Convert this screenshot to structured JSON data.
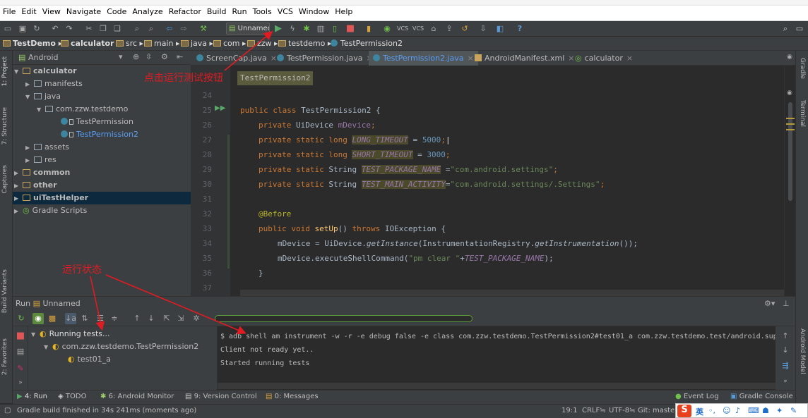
{
  "menu": [
    "File",
    "Edit",
    "View",
    "Navigate",
    "Code",
    "Analyze",
    "Refactor",
    "Build",
    "Run",
    "Tools",
    "VCS",
    "Window",
    "Help"
  ],
  "toolbar": {
    "run_config": "Unnamed"
  },
  "breadcrumb": [
    "TestDemo",
    "calculator",
    "src",
    "main",
    "java",
    "com",
    "zzw",
    "testdemo",
    "TestPermission2"
  ],
  "project_panel": {
    "module_selector": "Android",
    "tree": [
      {
        "label": "calculator"
      },
      {
        "label": "manifests"
      },
      {
        "label": "java"
      },
      {
        "label": "com.zzw.testdemo"
      },
      {
        "label": "TestPermission"
      },
      {
        "label": "TestPermission2"
      },
      {
        "label": "assets"
      },
      {
        "label": "res"
      },
      {
        "label": "common"
      },
      {
        "label": "other"
      },
      {
        "label": "uiTestHelper"
      },
      {
        "label": "Gradle Scripts"
      }
    ]
  },
  "side_tabs_left": [
    "1: Project",
    "7: Structure",
    "Captures",
    "Build Variants",
    "2: Favorites"
  ],
  "side_tabs_right": [
    "Gradle",
    "Terminal",
    "Android Model"
  ],
  "editor_tabs": [
    {
      "label": "ScreenCap.java"
    },
    {
      "label": "TestPermission.java"
    },
    {
      "label": "TestPermission2.java"
    },
    {
      "label": "AndroidManifest.xml"
    },
    {
      "label": "calculator"
    }
  ],
  "editor": {
    "popup": "TestPermission2",
    "line_numbers": [
      "24",
      "25",
      "26",
      "27",
      "28",
      "29",
      "30",
      "31",
      "32",
      "33",
      "34",
      "35",
      "36",
      "37"
    ],
    "code": {
      "l25": [
        "public class ",
        "TestPermission2 {"
      ],
      "l26": [
        "private ",
        "UiDevice ",
        "mDevice",
        ";"
      ],
      "l27": [
        "private static long ",
        "LONG_TIMEOUT",
        " = ",
        "5000",
        ";"
      ],
      "l28": [
        "private static long ",
        "SHORT_TIMEOUT",
        " = ",
        "3000",
        ";"
      ],
      "l29": [
        "private static ",
        "String ",
        "TEST_PACKAGE_NAME",
        " =",
        "\"com.android.settings\"",
        ";"
      ],
      "l30": [
        "private static ",
        "String ",
        "TEST_MAIN_ACTIVITY",
        "=",
        "\"com.android.settings/.Settings\"",
        ";"
      ],
      "l32": [
        "@Before"
      ],
      "l33": [
        "public void ",
        "setUp",
        "() ",
        "throws ",
        "IOException {"
      ],
      "l34": [
        "mDevice = UiDevice.",
        "getInstance",
        "(InstrumentationRegistry.",
        "getInstrumentation",
        "());"
      ],
      "l35": [
        "mDevice.executeShellCommand(",
        "\"pm clear \"",
        "+",
        "TEST_PACKAGE_NAME",
        ");"
      ],
      "l36": [
        "}"
      ]
    }
  },
  "run_panel": {
    "title_prefix": "Run",
    "config": "Unnamed",
    "tree": [
      "Running tests...",
      "com.zzw.testdemo.TestPermission2",
      "test01_a"
    ],
    "console": [
      "$ adb shell am instrument -w -r   -e debug false -e class com.zzw.testdemo.TestPermission2#test01_a com.zzw.testdemo.test/android.supp",
      "Client not ready yet..",
      "Started running tests"
    ]
  },
  "tool_windows": [
    "4: Run",
    "TODO",
    "6: Android Monitor",
    "9: Version Control",
    "0: Messages",
    "Event Log",
    "Gradle Console"
  ],
  "status": {
    "message": "Gradle build finished in 34s 241ms (moments ago)",
    "position": "19:1",
    "line_sep": "CRLF≒",
    "encoding": "UTF-8≒",
    "git": "Git: master"
  },
  "annotations": {
    "run_button": "点击运行测试按钮",
    "run_status": "运行状态"
  },
  "ime": {
    "logo": "S",
    "lang": "英"
  }
}
